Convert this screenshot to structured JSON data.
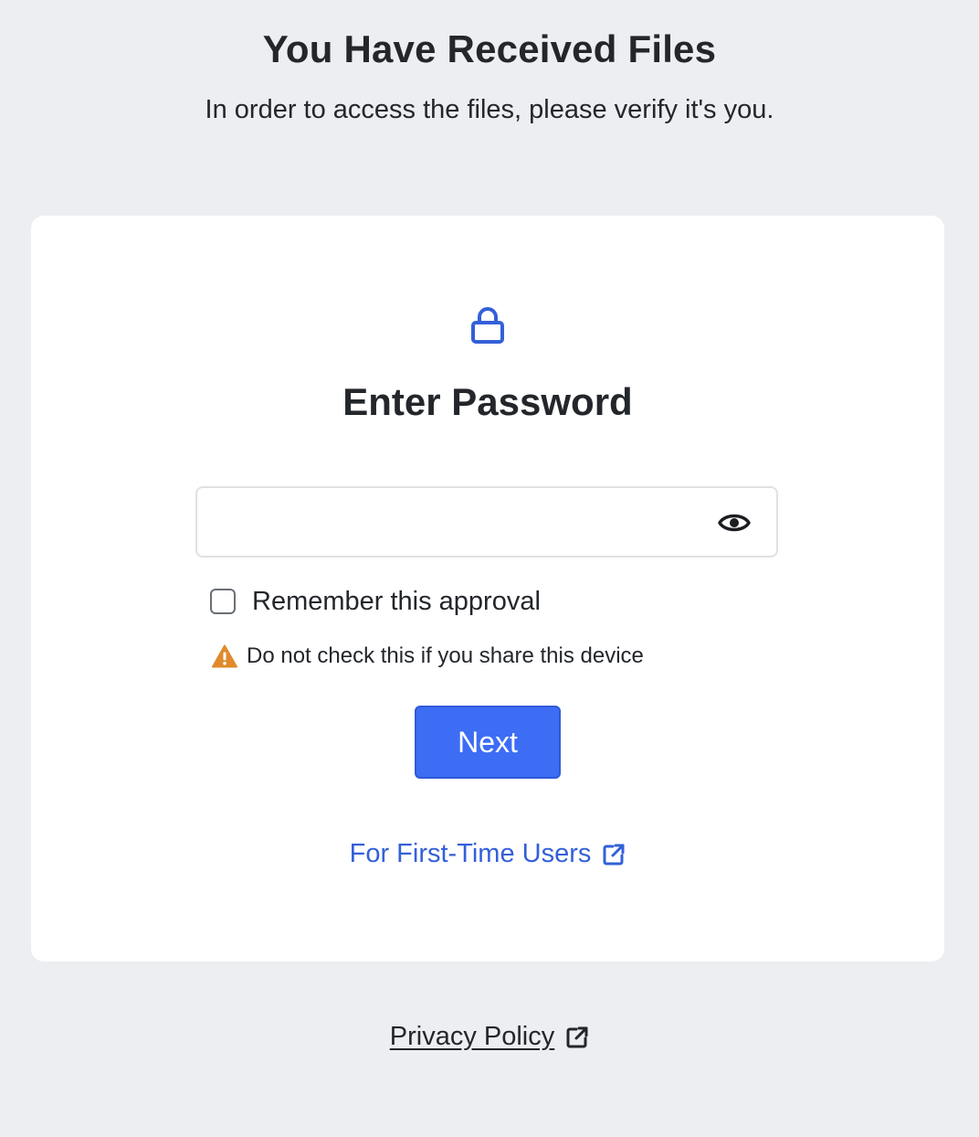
{
  "header": {
    "title": "You Have Received Files",
    "subtitle": "In order to access the files, please verify it's you."
  },
  "card": {
    "icon": "lock-icon",
    "title": "Enter Password",
    "password_field": {
      "value": "",
      "placeholder": "",
      "toggle_icon": "eye-icon"
    },
    "remember": {
      "label": "Remember this approval",
      "checked": false
    },
    "warning": {
      "icon": "warning-icon",
      "text": "Do not check this if you share this device"
    },
    "next_button_label": "Next",
    "first_time_link": {
      "label": "For First-Time Users",
      "icon": "external-link-icon"
    }
  },
  "footer": {
    "privacy_label": "Privacy Policy",
    "privacy_icon": "external-link-icon"
  },
  "colors": {
    "background": "#eceef1",
    "card": "#ffffff",
    "accent": "#3d6cf5",
    "link": "#3460d8",
    "warning": "#e08a2c",
    "text": "#23262b"
  }
}
